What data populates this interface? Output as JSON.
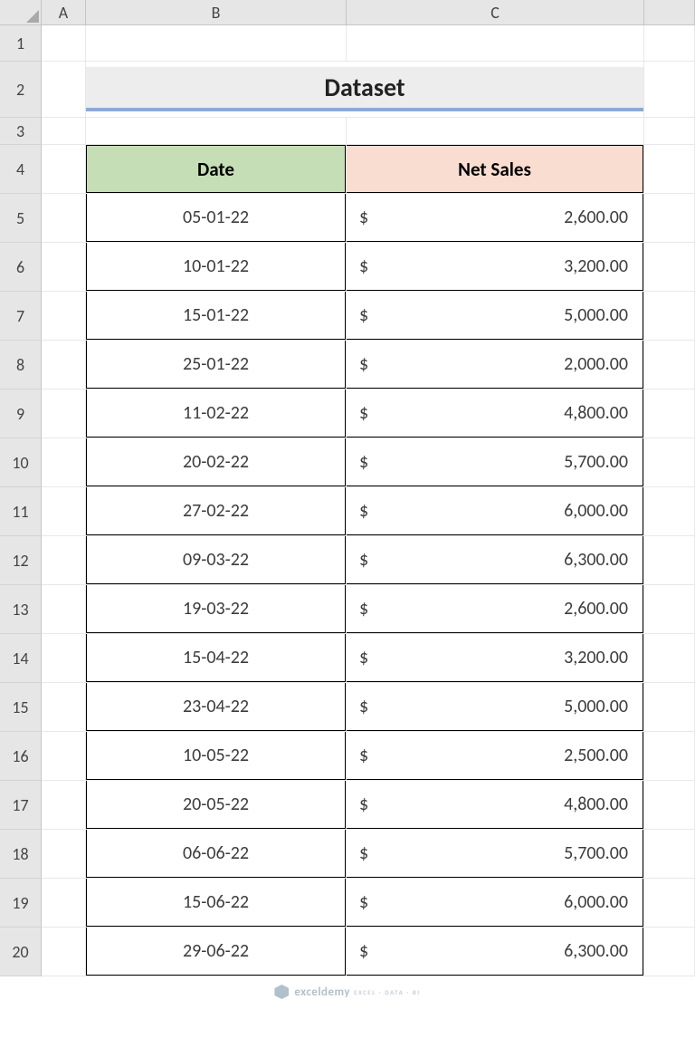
{
  "columns": [
    "",
    "A",
    "B",
    "C",
    ""
  ],
  "row_numbers": [
    "1",
    "2",
    "3",
    "4",
    "5",
    "6",
    "7",
    "8",
    "9",
    "10",
    "11",
    "12",
    "13",
    "14",
    "15",
    "16",
    "17",
    "18",
    "19",
    "20"
  ],
  "title": "Dataset",
  "headers": {
    "date": "Date",
    "sales": "Net Sales"
  },
  "currency": "$",
  "rows": [
    {
      "date": "05-01-22",
      "sales": "2,600.00"
    },
    {
      "date": "10-01-22",
      "sales": "3,200.00"
    },
    {
      "date": "15-01-22",
      "sales": "5,000.00"
    },
    {
      "date": "25-01-22",
      "sales": "2,000.00"
    },
    {
      "date": "11-02-22",
      "sales": "4,800.00"
    },
    {
      "date": "20-02-22",
      "sales": "5,700.00"
    },
    {
      "date": "27-02-22",
      "sales": "6,000.00"
    },
    {
      "date": "09-03-22",
      "sales": "6,300.00"
    },
    {
      "date": "19-03-22",
      "sales": "2,600.00"
    },
    {
      "date": "15-04-22",
      "sales": "3,200.00"
    },
    {
      "date": "23-04-22",
      "sales": "5,000.00"
    },
    {
      "date": "10-05-22",
      "sales": "2,500.00"
    },
    {
      "date": "20-05-22",
      "sales": "4,800.00"
    },
    {
      "date": "06-06-22",
      "sales": "5,700.00"
    },
    {
      "date": "15-06-22",
      "sales": "6,000.00"
    },
    {
      "date": "29-06-22",
      "sales": "6,300.00"
    }
  ],
  "watermark": {
    "brand": "exceldemy",
    "tagline": "EXCEL · DATA · BI"
  }
}
